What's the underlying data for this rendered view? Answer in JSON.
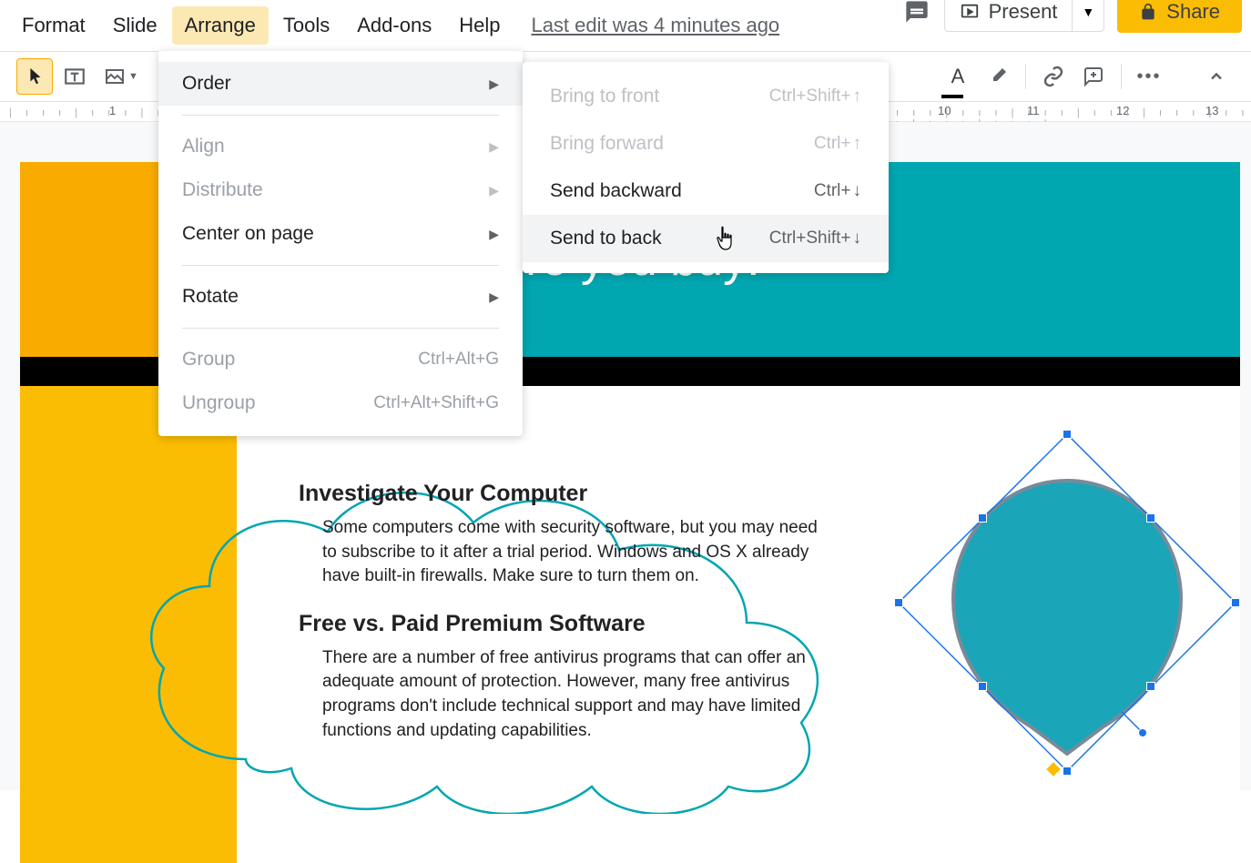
{
  "menubar": {
    "items": [
      "Format",
      "Slide",
      "Arrange",
      "Tools",
      "Add-ons",
      "Help"
    ],
    "active_index": 2,
    "last_edit": "Last edit was 4 minutes ago"
  },
  "buttons": {
    "present": "Present",
    "share": "Share"
  },
  "ruler": {
    "left": "1",
    "marks": [
      "10",
      "11",
      "12",
      "13"
    ]
  },
  "dropdown": {
    "items": [
      {
        "label": "Order",
        "submenu": true,
        "enabled": true,
        "hover": true
      },
      {
        "sep": true
      },
      {
        "label": "Align",
        "submenu": true,
        "enabled": false
      },
      {
        "label": "Distribute",
        "submenu": true,
        "enabled": false
      },
      {
        "label": "Center on page",
        "submenu": true,
        "enabled": true
      },
      {
        "sep": true
      },
      {
        "label": "Rotate",
        "submenu": true,
        "enabled": true
      },
      {
        "sep": true
      },
      {
        "label": "Group",
        "shortcut": "Ctrl+Alt+G",
        "enabled": false
      },
      {
        "label": "Ungroup",
        "shortcut": "Ctrl+Alt+Shift+G",
        "enabled": false
      }
    ]
  },
  "submenu": {
    "items": [
      {
        "label": "Bring to front",
        "shortcut": "Ctrl+Shift+",
        "arrow": "↑",
        "enabled": false
      },
      {
        "label": "Bring forward",
        "shortcut": "Ctrl+",
        "arrow": "↑",
        "enabled": false
      },
      {
        "label": "Send backward",
        "shortcut": "Ctrl+",
        "arrow": "↓",
        "enabled": true
      },
      {
        "label": "Send to back",
        "shortcut": "Ctrl+Shift+",
        "arrow": "↓",
        "enabled": true,
        "hover": true
      }
    ]
  },
  "slide": {
    "header": "nsider before you buy:",
    "section1_title": "Investigate Your Computer",
    "section1_body": "Some computers come with security software, but you may need to subscribe to it after a trial period. Windows and OS X already have built-in firewalls. Make sure to turn them on.",
    "section2_title": "Free vs. Paid Premium Software",
    "section2_body": "There are a number of free antivirus programs that can offer an adequate amount of protection. However, many free antivirus programs don't include technical support and may have limited functions and updating capabilities."
  },
  "colors": {
    "teal": "#00a6b0",
    "yellow": "#fbbc04",
    "orange": "#f9ab00",
    "selection": "#1a73e8"
  }
}
